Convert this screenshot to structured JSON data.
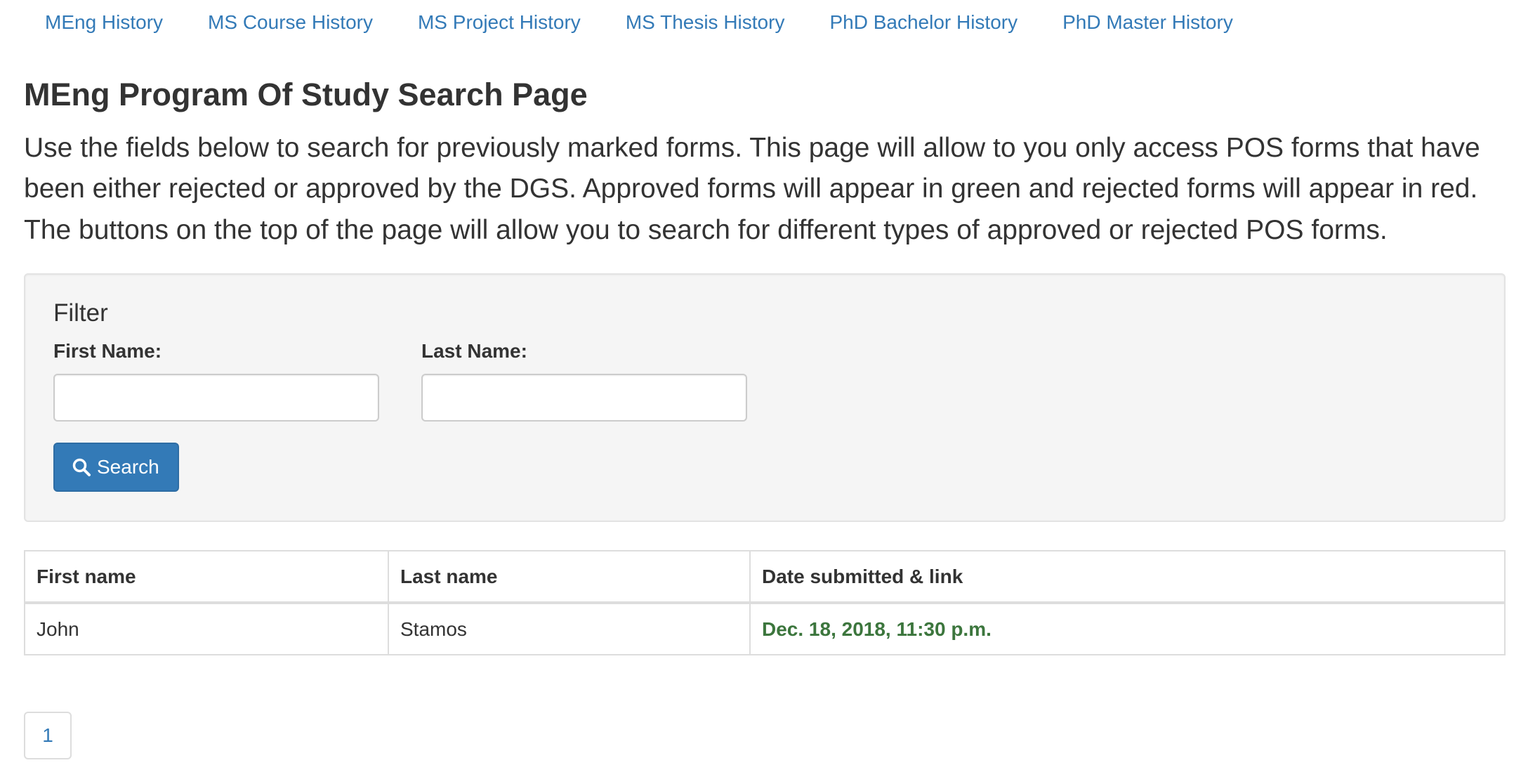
{
  "nav": {
    "links": [
      {
        "label": "MEng History"
      },
      {
        "label": "MS Course History"
      },
      {
        "label": "MS Project History"
      },
      {
        "label": "MS Thesis History"
      },
      {
        "label": "PhD Bachelor History"
      },
      {
        "label": "PhD Master History"
      }
    ]
  },
  "page": {
    "title": "MEng Program Of Study Search Page",
    "intro": "Use the fields below to search for previously marked forms. This page will allow to you only access POS forms that have been either rejected or approved by the DGS. Approved forms will appear in green and rejected forms will appear in red. The buttons on the top of the page will allow you to search for different types of approved or rejected POS forms."
  },
  "filter": {
    "heading": "Filter",
    "first_name": {
      "label": "First Name:",
      "value": "",
      "placeholder": ""
    },
    "last_name": {
      "label": "Last Name:",
      "value": "",
      "placeholder": ""
    },
    "search_label": "Search",
    "search_icon": "search-icon"
  },
  "table": {
    "headers": {
      "first": "First name",
      "last": "Last name",
      "date": "Date submitted & link"
    },
    "rows": [
      {
        "first": "John",
        "last": "Stamos",
        "date": "Dec. 18, 2018, 11:30 p.m.",
        "status": "approved"
      }
    ]
  },
  "pagination": {
    "pages": [
      "1"
    ],
    "current": "1"
  },
  "colors": {
    "link": "#337ab7",
    "approved": "#3c763d",
    "button": "#337ab7"
  }
}
